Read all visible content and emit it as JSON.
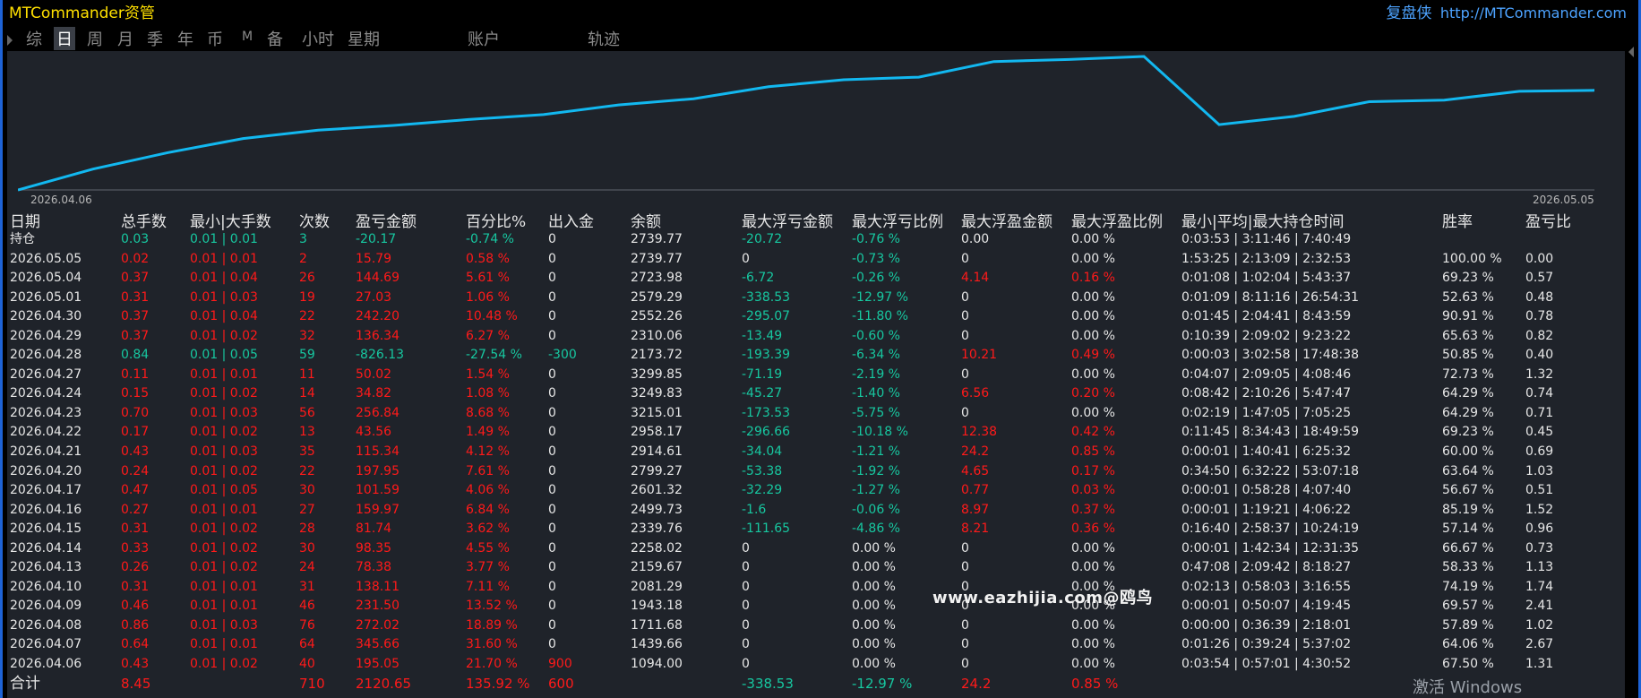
{
  "app": {
    "title": "MTCommander资管",
    "brand": "复盘侠",
    "brand_url": "http://MTCommander.com"
  },
  "tabs": [
    {
      "label": "综",
      "active": false
    },
    {
      "label": "日",
      "active": true
    },
    {
      "label": "周",
      "active": false
    },
    {
      "label": "月",
      "active": false
    },
    {
      "label": "季",
      "active": false
    },
    {
      "label": "年",
      "active": false
    },
    {
      "label": "币",
      "active": false
    },
    {
      "label": "M",
      "active": false
    },
    {
      "label": "备",
      "active": false
    },
    {
      "label": "小时",
      "active": false
    },
    {
      "label": "星期",
      "active": false
    },
    {
      "label": "账户",
      "active": false
    },
    {
      "label": "轨迹",
      "active": false
    }
  ],
  "chart_data": {
    "type": "line",
    "x": [
      "2026.04.06",
      "2026.04.07",
      "2026.04.08",
      "2026.04.09",
      "2026.04.10",
      "2026.04.13",
      "2026.04.14",
      "2026.04.15",
      "2026.04.16",
      "2026.04.17",
      "2026.04.20",
      "2026.04.21",
      "2026.04.22",
      "2026.04.23",
      "2026.04.24",
      "2026.04.27",
      "2026.04.28",
      "2026.04.29",
      "2026.04.30",
      "2026.05.01",
      "2026.05.04",
      "2026.05.05"
    ],
    "series": [
      {
        "values": [
          1094.0,
          1439.66,
          1711.68,
          1943.18,
          2081.29,
          2159.67,
          2258.02,
          2339.76,
          2499.73,
          2601.32,
          2799.27,
          2914.61,
          2958.17,
          3215.01,
          3249.83,
          3299.85,
          2173.72,
          2310.06,
          2552.26,
          2579.29,
          2723.98,
          2739.77
        ]
      }
    ],
    "x_start_label": "2026.04.06",
    "x_end_label": "2026.05.05",
    "ylim": [
      1094,
      3300
    ],
    "grid": false
  },
  "colors": {
    "positive": "#ff1a1a",
    "negative": "#17c7a0",
    "neutral": "#e6e6e6",
    "curve": "#12b8f0",
    "title": "#ffe000",
    "link": "#4da3ff"
  },
  "table": {
    "headers": [
      "日期",
      "总手数",
      "最小|大手数",
      "次数",
      "盈亏金额",
      "百分比%",
      "出入金",
      "余额",
      "最大浮亏金额",
      "最大浮亏比例",
      "最大浮盈金额",
      "最大浮盈比例",
      "最小|平均|最大持仓时间",
      "胜率",
      "盈亏比"
    ],
    "rows": [
      {
        "cells": [
          "持仓",
          "0.03",
          "0.01 | 0.01",
          "3",
          "-20.17",
          "-0.74 %",
          "0",
          "2739.77",
          "-20.72",
          "-0.76 %",
          "0.00",
          "0.00 %",
          "0:03:53 | 3:11:46 | 7:40:49",
          "",
          ""
        ],
        "colors": [
          "w",
          "g",
          "g",
          "g",
          "g",
          "g",
          "w",
          "w",
          "g",
          "g",
          "w",
          "w",
          "w",
          "w",
          "w"
        ]
      },
      {
        "cells": [
          "2026.05.05",
          "0.02",
          "0.01 | 0.01",
          "2",
          "15.79",
          "0.58 %",
          "0",
          "2739.77",
          "0",
          "-0.73 %",
          "0",
          "0.00 %",
          "1:53:25 | 2:13:09 | 2:32:53",
          "100.00 %",
          "0.00"
        ],
        "colors": [
          "w",
          "r",
          "r",
          "r",
          "r",
          "r",
          "w",
          "w",
          "w",
          "g",
          "w",
          "w",
          "w",
          "w",
          "w"
        ]
      },
      {
        "cells": [
          "2026.05.04",
          "0.37",
          "0.01 | 0.04",
          "26",
          "144.69",
          "5.61 %",
          "0",
          "2723.98",
          "-6.72",
          "-0.26 %",
          "4.14",
          "0.16 %",
          "0:01:08 | 1:02:04 | 5:43:37",
          "69.23 %",
          "0.57"
        ],
        "colors": [
          "w",
          "r",
          "r",
          "r",
          "r",
          "r",
          "w",
          "w",
          "g",
          "g",
          "r",
          "r",
          "w",
          "w",
          "w"
        ]
      },
      {
        "cells": [
          "2026.05.01",
          "0.31",
          "0.01 | 0.03",
          "19",
          "27.03",
          "1.06 %",
          "0",
          "2579.29",
          "-338.53",
          "-12.97 %",
          "0",
          "0.00 %",
          "0:01:09 | 8:11:16 | 26:54:31",
          "52.63 %",
          "0.48"
        ],
        "colors": [
          "w",
          "r",
          "r",
          "r",
          "r",
          "r",
          "w",
          "w",
          "g",
          "g",
          "w",
          "w",
          "w",
          "w",
          "w"
        ]
      },
      {
        "cells": [
          "2026.04.30",
          "0.37",
          "0.01 | 0.04",
          "22",
          "242.20",
          "10.48 %",
          "0",
          "2552.26",
          "-295.07",
          "-11.80 %",
          "0",
          "0.00 %",
          "0:01:45 | 2:04:41 | 8:43:59",
          "90.91 %",
          "0.78"
        ],
        "colors": [
          "w",
          "r",
          "r",
          "r",
          "r",
          "r",
          "w",
          "w",
          "g",
          "g",
          "w",
          "w",
          "w",
          "w",
          "w"
        ]
      },
      {
        "cells": [
          "2026.04.29",
          "0.37",
          "0.01 | 0.02",
          "32",
          "136.34",
          "6.27 %",
          "0",
          "2310.06",
          "-13.49",
          "-0.60 %",
          "0",
          "0.00 %",
          "0:10:39 | 2:09:02 | 9:23:22",
          "65.63 %",
          "0.82"
        ],
        "colors": [
          "w",
          "r",
          "r",
          "r",
          "r",
          "r",
          "w",
          "w",
          "g",
          "g",
          "w",
          "w",
          "w",
          "w",
          "w"
        ]
      },
      {
        "cells": [
          "2026.04.28",
          "0.84",
          "0.01 | 0.05",
          "59",
          "-826.13",
          "-27.54 %",
          "-300",
          "2173.72",
          "-193.39",
          "-6.34 %",
          "10.21",
          "0.49 %",
          "0:00:03 | 3:02:58 | 17:48:38",
          "50.85 %",
          "0.40"
        ],
        "colors": [
          "w",
          "g",
          "g",
          "g",
          "g",
          "g",
          "g",
          "w",
          "g",
          "g",
          "r",
          "r",
          "w",
          "w",
          "w"
        ]
      },
      {
        "cells": [
          "2026.04.27",
          "0.11",
          "0.01 | 0.01",
          "11",
          "50.02",
          "1.54 %",
          "0",
          "3299.85",
          "-71.19",
          "-2.19 %",
          "0",
          "0.00 %",
          "0:04:07 | 2:09:05 | 4:08:46",
          "72.73 %",
          "1.32"
        ],
        "colors": [
          "w",
          "r",
          "r",
          "r",
          "r",
          "r",
          "w",
          "w",
          "g",
          "g",
          "w",
          "w",
          "w",
          "w",
          "w"
        ]
      },
      {
        "cells": [
          "2026.04.24",
          "0.15",
          "0.01 | 0.02",
          "14",
          "34.82",
          "1.08 %",
          "0",
          "3249.83",
          "-45.27",
          "-1.40 %",
          "6.56",
          "0.20 %",
          "0:08:42 | 2:10:26 | 5:47:47",
          "64.29 %",
          "0.74"
        ],
        "colors": [
          "w",
          "r",
          "r",
          "r",
          "r",
          "r",
          "w",
          "w",
          "g",
          "g",
          "r",
          "r",
          "w",
          "w",
          "w"
        ]
      },
      {
        "cells": [
          "2026.04.23",
          "0.70",
          "0.01 | 0.03",
          "56",
          "256.84",
          "8.68 %",
          "0",
          "3215.01",
          "-173.53",
          "-5.75 %",
          "0",
          "0.00 %",
          "0:02:19 | 1:47:05 | 7:05:25",
          "64.29 %",
          "0.71"
        ],
        "colors": [
          "w",
          "r",
          "r",
          "r",
          "r",
          "r",
          "w",
          "w",
          "g",
          "g",
          "w",
          "w",
          "w",
          "w",
          "w"
        ]
      },
      {
        "cells": [
          "2026.04.22",
          "0.17",
          "0.01 | 0.02",
          "13",
          "43.56",
          "1.49 %",
          "0",
          "2958.17",
          "-296.66",
          "-10.18 %",
          "12.38",
          "0.42 %",
          "0:11:45 | 8:34:43 | 18:49:59",
          "69.23 %",
          "0.45"
        ],
        "colors": [
          "w",
          "r",
          "r",
          "r",
          "r",
          "r",
          "w",
          "w",
          "g",
          "g",
          "r",
          "r",
          "w",
          "w",
          "w"
        ]
      },
      {
        "cells": [
          "2026.04.21",
          "0.43",
          "0.01 | 0.03",
          "35",
          "115.34",
          "4.12 %",
          "0",
          "2914.61",
          "-34.04",
          "-1.21 %",
          "24.2",
          "0.85 %",
          "0:00:01 | 1:40:41 | 6:25:32",
          "60.00 %",
          "0.69"
        ],
        "colors": [
          "w",
          "r",
          "r",
          "r",
          "r",
          "r",
          "w",
          "w",
          "g",
          "g",
          "r",
          "r",
          "w",
          "w",
          "w"
        ]
      },
      {
        "cells": [
          "2026.04.20",
          "0.24",
          "0.01 | 0.02",
          "22",
          "197.95",
          "7.61 %",
          "0",
          "2799.27",
          "-53.38",
          "-1.92 %",
          "4.65",
          "0.17 %",
          "0:34:50 | 6:32:22 | 53:07:18",
          "63.64 %",
          "1.03"
        ],
        "colors": [
          "w",
          "r",
          "r",
          "r",
          "r",
          "r",
          "w",
          "w",
          "g",
          "g",
          "r",
          "r",
          "w",
          "w",
          "w"
        ]
      },
      {
        "cells": [
          "2026.04.17",
          "0.47",
          "0.01 | 0.05",
          "30",
          "101.59",
          "4.06 %",
          "0",
          "2601.32",
          "-32.29",
          "-1.27 %",
          "0.77",
          "0.03 %",
          "0:00:01 | 0:58:28 | 4:07:40",
          "56.67 %",
          "0.51"
        ],
        "colors": [
          "w",
          "r",
          "r",
          "r",
          "r",
          "r",
          "w",
          "w",
          "g",
          "g",
          "r",
          "r",
          "w",
          "w",
          "w"
        ]
      },
      {
        "cells": [
          "2026.04.16",
          "0.27",
          "0.01 | 0.01",
          "27",
          "159.97",
          "6.84 %",
          "0",
          "2499.73",
          "-1.6",
          "-0.06 %",
          "8.97",
          "0.37 %",
          "0:00:01 | 1:19:21 | 4:06:22",
          "85.19 %",
          "1.52"
        ],
        "colors": [
          "w",
          "r",
          "r",
          "r",
          "r",
          "r",
          "w",
          "w",
          "g",
          "g",
          "r",
          "r",
          "w",
          "w",
          "w"
        ]
      },
      {
        "cells": [
          "2026.04.15",
          "0.31",
          "0.01 | 0.02",
          "28",
          "81.74",
          "3.62 %",
          "0",
          "2339.76",
          "-111.65",
          "-4.86 %",
          "8.21",
          "0.36 %",
          "0:16:40 | 2:58:37 | 10:24:19",
          "57.14 %",
          "0.96"
        ],
        "colors": [
          "w",
          "r",
          "r",
          "r",
          "r",
          "r",
          "w",
          "w",
          "g",
          "g",
          "r",
          "r",
          "w",
          "w",
          "w"
        ]
      },
      {
        "cells": [
          "2026.04.14",
          "0.33",
          "0.01 | 0.02",
          "30",
          "98.35",
          "4.55 %",
          "0",
          "2258.02",
          "0",
          "0.00 %",
          "0",
          "0.00 %",
          "0:00:01 | 1:42:34 | 12:31:35",
          "66.67 %",
          "0.73"
        ],
        "colors": [
          "w",
          "r",
          "r",
          "r",
          "r",
          "r",
          "w",
          "w",
          "w",
          "w",
          "w",
          "w",
          "w",
          "w",
          "w"
        ]
      },
      {
        "cells": [
          "2026.04.13",
          "0.26",
          "0.01 | 0.02",
          "24",
          "78.38",
          "3.77 %",
          "0",
          "2159.67",
          "0",
          "0.00 %",
          "0",
          "0.00 %",
          "0:47:08 | 2:09:42 | 8:18:27",
          "58.33 %",
          "1.13"
        ],
        "colors": [
          "w",
          "r",
          "r",
          "r",
          "r",
          "r",
          "w",
          "w",
          "w",
          "w",
          "w",
          "w",
          "w",
          "w",
          "w"
        ]
      },
      {
        "cells": [
          "2026.04.10",
          "0.31",
          "0.01 | 0.01",
          "31",
          "138.11",
          "7.11 %",
          "0",
          "2081.29",
          "0",
          "0.00 %",
          "0",
          "0.00 %",
          "0:02:13 | 0:58:03 | 3:16:55",
          "74.19 %",
          "1.74"
        ],
        "colors": [
          "w",
          "r",
          "r",
          "r",
          "r",
          "r",
          "w",
          "w",
          "w",
          "w",
          "w",
          "w",
          "w",
          "w",
          "w"
        ]
      },
      {
        "cells": [
          "2026.04.09",
          "0.46",
          "0.01 | 0.01",
          "46",
          "231.50",
          "13.52 %",
          "0",
          "1943.18",
          "0",
          "0.00 %",
          "0",
          "0.00 %",
          "0:00:01 | 0:50:07 | 4:19:45",
          "69.57 %",
          "2.41"
        ],
        "colors": [
          "w",
          "r",
          "r",
          "r",
          "r",
          "r",
          "w",
          "w",
          "w",
          "w",
          "w",
          "w",
          "w",
          "w",
          "w"
        ]
      },
      {
        "cells": [
          "2026.04.08",
          "0.86",
          "0.01 | 0.03",
          "76",
          "272.02",
          "18.89 %",
          "0",
          "1711.68",
          "0",
          "0.00 %",
          "0",
          "0.00 %",
          "0:00:00 | 0:36:39 | 2:18:01",
          "57.89 %",
          "1.02"
        ],
        "colors": [
          "w",
          "r",
          "r",
          "r",
          "r",
          "r",
          "w",
          "w",
          "w",
          "w",
          "w",
          "w",
          "w",
          "w",
          "w"
        ]
      },
      {
        "cells": [
          "2026.04.07",
          "0.64",
          "0.01 | 0.01",
          "64",
          "345.66",
          "31.60 %",
          "0",
          "1439.66",
          "0",
          "0.00 %",
          "0",
          "0.00 %",
          "0:01:26 | 0:39:24 | 5:37:02",
          "64.06 %",
          "2.67"
        ],
        "colors": [
          "w",
          "r",
          "r",
          "r",
          "r",
          "r",
          "w",
          "w",
          "w",
          "w",
          "w",
          "w",
          "w",
          "w",
          "w"
        ]
      },
      {
        "cells": [
          "2026.04.06",
          "0.43",
          "0.01 | 0.02",
          "40",
          "195.05",
          "21.70 %",
          "900",
          "1094.00",
          "0",
          "0.00 %",
          "0",
          "0.00 %",
          "0:03:54 | 0:57:01 | 4:30:52",
          "67.50 %",
          "1.31"
        ],
        "colors": [
          "w",
          "r",
          "r",
          "r",
          "r",
          "r",
          "r",
          "w",
          "w",
          "w",
          "w",
          "w",
          "w",
          "w",
          "w"
        ]
      }
    ],
    "total": {
      "cells": [
        "合计",
        "8.45",
        "",
        "710",
        "2120.65",
        "135.92 %",
        "600",
        "",
        "-338.53",
        "-12.97 %",
        "24.2",
        "0.85 %",
        "",
        "",
        ""
      ],
      "colors": [
        "w",
        "r",
        "w",
        "r",
        "r",
        "r",
        "r",
        "w",
        "g",
        "g",
        "r",
        "r",
        "w",
        "w",
        "w"
      ]
    }
  },
  "watermark": "www.eazhijia.com@鸥鸟",
  "windows_activation": "激活 Windows"
}
